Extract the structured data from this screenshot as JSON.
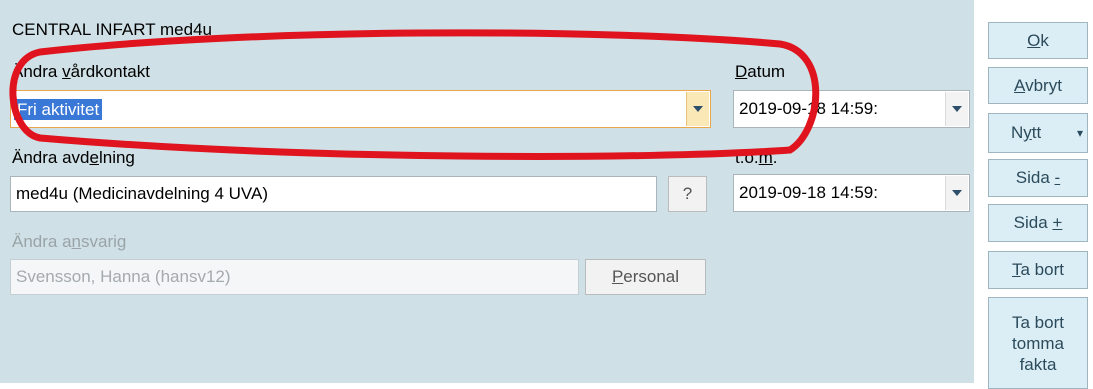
{
  "header": {
    "title": "CENTRAL INFART med4u"
  },
  "vardkontakt": {
    "label_pre": "Ändra ",
    "label_key": "v",
    "label_post": "årdkontakt",
    "value": "Fri aktivitet"
  },
  "datum": {
    "label_key": "D",
    "label_post": "atum",
    "value": "2019-09-18 14:59:"
  },
  "avdelning": {
    "label_pre": "Ändra avd",
    "label_key": "e",
    "label_post": "lning",
    "value": "med4u (Medicinavdelning 4 UVA)",
    "help_label": "?"
  },
  "tom": {
    "label_pre": "t.o.",
    "label_key": "m",
    "label_post": ".",
    "value": "2019-09-18 14:59:"
  },
  "ansvarig": {
    "label_pre": "Ändra a",
    "label_key": "n",
    "label_post": "svarig",
    "value": "Svensson, Hanna (hansv12)",
    "personal_key": "P",
    "personal_post": "ersonal"
  },
  "buttons": {
    "ok_key": "O",
    "ok_post": "k",
    "avbryt_key": "A",
    "avbryt_post": "vbryt",
    "nytt_pre": "N",
    "nytt_key": "y",
    "nytt_post": "tt",
    "nytt_arrow": "▾",
    "sida_minus_pre": "Sida ",
    "sida_minus_key": "-",
    "sida_plus_pre": "Sida ",
    "sida_plus_key": "+",
    "ta_bort_key": "T",
    "ta_bort_post": "a bort",
    "ta_bort_tomma_l1": "Ta bort",
    "ta_bort_tomma_l2": "tomma",
    "ta_bort_tomma_l3": "fakta"
  },
  "colors": {
    "panel": "#cfe0e6",
    "highlight_oval": "#e0141e",
    "selection": "#3a78d8",
    "focus_border": "#e8a74d"
  }
}
